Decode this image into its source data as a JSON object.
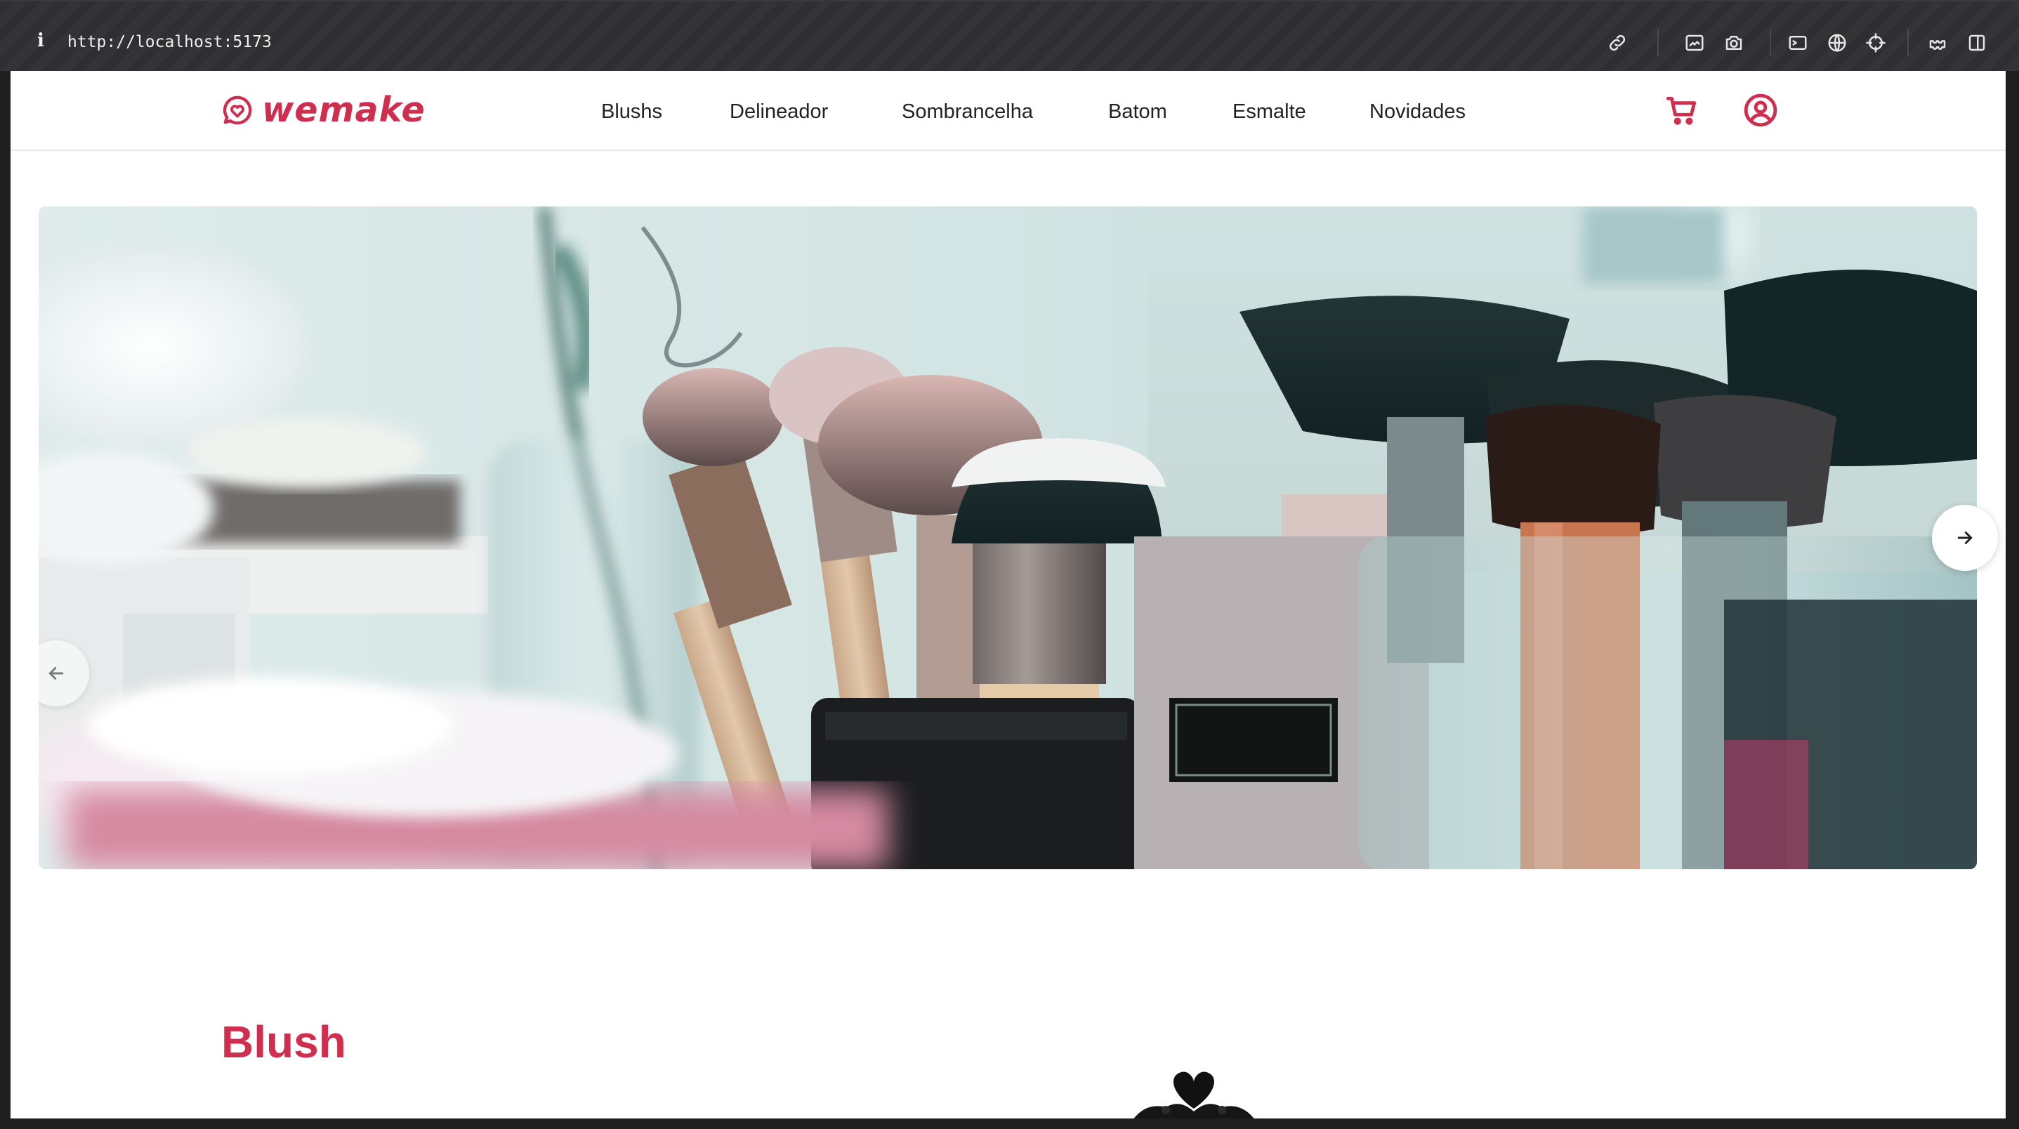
{
  "browser": {
    "info_glyph": "i",
    "url": "http://localhost:5173",
    "toolbar_icons": [
      "link-icon",
      "screenshot-area-icon",
      "camera-icon",
      "terminal-icon",
      "globe-icon",
      "crosshair-icon",
      "extensions-icon",
      "sidebar-icon"
    ]
  },
  "header": {
    "logo_text": "wemake",
    "nav": [
      {
        "label": "Blushs"
      },
      {
        "label": "Delineador"
      },
      {
        "label": "Sombrancelha"
      },
      {
        "label": "Batom"
      },
      {
        "label": "Esmalte"
      },
      {
        "label": "Novidades"
      }
    ],
    "icons": [
      "cart-icon",
      "user-icon"
    ]
  },
  "carousel": {
    "image_description": "makeup brushes in jars on a dressing table",
    "prev_icon": "arrow-left-icon",
    "next_icon": "arrow-right-icon"
  },
  "section": {
    "title": "Blush"
  },
  "colors": {
    "brand": "#cf2e4f",
    "text": "#222222",
    "chrome_bg": "#2f2f31"
  }
}
